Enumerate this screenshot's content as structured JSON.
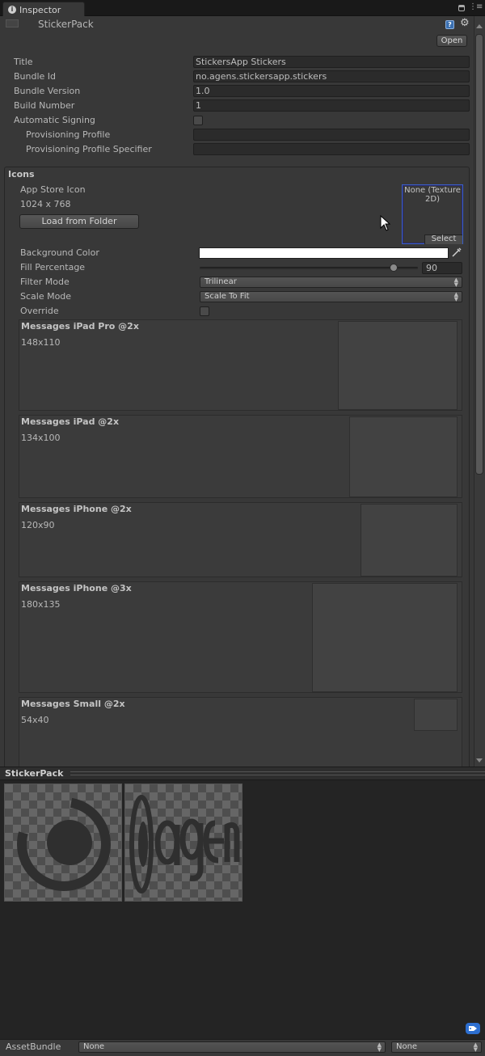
{
  "window": {
    "tab_title": "Inspector",
    "asset_name": "StickerPack",
    "open_button": "Open"
  },
  "fields": {
    "title_label": "Title",
    "title_value": "StickersApp Stickers",
    "bundle_id_label": "Bundle Id",
    "bundle_id_value": "no.agens.stickersapp.stickers",
    "bundle_version_label": "Bundle Version",
    "bundle_version_value": "1.0",
    "build_number_label": "Build Number",
    "build_number_value": "1",
    "auto_signing_label": "Automatic Signing",
    "auto_signing_checked": false,
    "prov_profile_label": "Provisioning Profile",
    "prov_profile_value": "",
    "prov_specifier_label": "Provisioning Profile Specifier",
    "prov_specifier_value": ""
  },
  "icons": {
    "section_title": "Icons",
    "app_store_label": "App Store Icon",
    "app_store_size": "1024 x 768",
    "load_button": "Load from Folder",
    "texture_none": "None (Texture 2D)",
    "texture_select": "Select",
    "background_color_label": "Background Color",
    "background_color": "#ffffff",
    "fill_label": "Fill Percentage",
    "fill_value": "90",
    "filter_label": "Filter Mode",
    "filter_value": "Trilinear",
    "scale_label": "Scale Mode",
    "scale_value": "Scale To Fit",
    "override_label": "Override",
    "override_checked": false,
    "messages": [
      {
        "title": "Messages iPad Pro @2x",
        "size": "148x110"
      },
      {
        "title": "Messages iPad @2x",
        "size": "134x100"
      },
      {
        "title": "Messages iPhone @2x",
        "size": "120x90"
      },
      {
        "title": "Messages iPhone @3x",
        "size": "180x135"
      },
      {
        "title": "Messages Small @2x",
        "size": "54x40"
      }
    ]
  },
  "sticker_pack": {
    "title": "StickerPack"
  },
  "asset_bundle": {
    "label": "AssetBundle",
    "bundle_value": "None",
    "variant_value": "None"
  }
}
